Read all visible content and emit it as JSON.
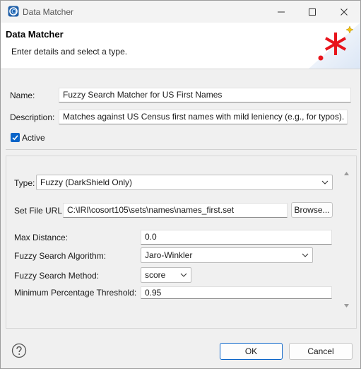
{
  "window": {
    "title": "Data Matcher",
    "icon": "app-logo-icon"
  },
  "banner": {
    "title": "Data Matcher",
    "message": "Enter details and select a type.",
    "accent_color": "#e8141c"
  },
  "form": {
    "name_label": "Name:",
    "name_value": "Fuzzy Search Matcher for US First Names",
    "description_label": "Description:",
    "description_value": "Matches against US Census first names with mild leniency (e.g., for typos).",
    "active_label": "Active",
    "active_checked": true
  },
  "details": {
    "type_label": "Type:",
    "type_value": "Fuzzy (DarkShield Only)",
    "set_file_label": "Set File URL:",
    "set_file_value": "C:\\IRI\\cosort105\\sets\\names\\names_first.set",
    "browse_label": "Browse...",
    "max_distance_label": "Max Distance:",
    "max_distance_value": "0.0",
    "algorithm_label": "Fuzzy Search Algorithm:",
    "algorithm_value": "Jaro-Winkler",
    "method_label": "Fuzzy Search Method:",
    "method_value": "score",
    "threshold_label": "Minimum Percentage Threshold:",
    "threshold_value": "0.95"
  },
  "footer": {
    "ok_label": "OK",
    "cancel_label": "Cancel",
    "help_icon": "help-icon"
  }
}
